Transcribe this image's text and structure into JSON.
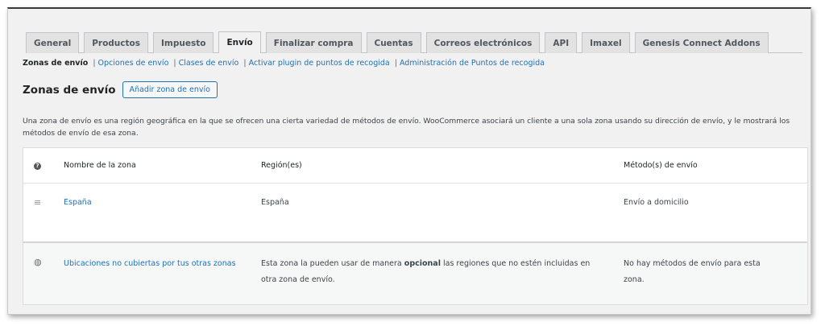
{
  "tabs": [
    {
      "label": "General"
    },
    {
      "label": "Productos"
    },
    {
      "label": "Impuesto"
    },
    {
      "label": "Envío",
      "active": true
    },
    {
      "label": "Finalizar compra"
    },
    {
      "label": "Cuentas"
    },
    {
      "label": "Correos electrónicos"
    },
    {
      "label": "API"
    },
    {
      "label": "Imaxel"
    },
    {
      "label": "Genesis Connect Addons"
    }
  ],
  "subnav": {
    "current": "Zonas de envío",
    "links": [
      "Opciones de envío",
      "Clases de envío",
      "Activar plugin de puntos de recogida",
      "Administración de Puntos de recogida"
    ],
    "separator": "|"
  },
  "page": {
    "title": "Zonas de envío",
    "add_button": "Añadir zona de envío",
    "description": "Una zona de envío es una región geográfica en la que se ofrecen una cierta variedad de métodos de envío. WooCommerce asociará un cliente a una sola zona usando su dirección de envío, y le mostrará los métodos de envío de esa zona."
  },
  "table": {
    "headers": {
      "name": "Nombre de la zona",
      "region": "Región(es)",
      "method": "Método(s) de envío"
    },
    "zones": [
      {
        "name": "España",
        "region": "España",
        "method": "Envío a domicilio"
      }
    ],
    "other": {
      "name": "Ubicaciones no cubiertas por tus otras zonas",
      "region_before": "Esta zona la pueden usar de manera",
      "region_bold": "opcional",
      "region_after": "las regiones que no estén incluidas en otra zona de envío.",
      "method": "No hay métodos de envío para esta zona."
    }
  },
  "icons": {
    "help": "help-icon",
    "drag": "drag-handle-icon",
    "globe": "globe-icon"
  },
  "colors": {
    "link": "#2271b1",
    "active_tab_bg": "#f1f1f1",
    "tab_bg": "#e2e2e2"
  }
}
